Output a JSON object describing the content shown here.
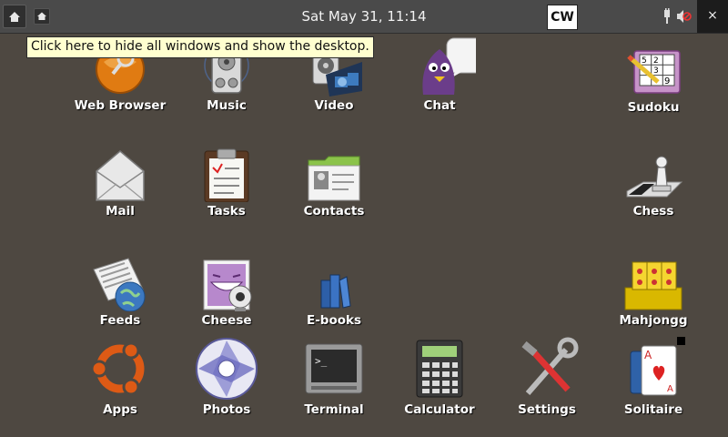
{
  "topbar": {
    "clock": "Sat May 31, 11:14",
    "cw_label": "CW",
    "close_label": "×"
  },
  "tooltip": "Click here to hide all windows and show the desktop.",
  "apps": {
    "web_browser": "Web Browser",
    "music": "Music",
    "video": "Video",
    "chat": "Chat",
    "sudoku": "Sudoku",
    "mail": "Mail",
    "tasks": "Tasks",
    "contacts": "Contacts",
    "chess": "Chess",
    "feeds": "Feeds",
    "cheese": "Cheese",
    "ebooks": "E-books",
    "mahjongg": "Mahjongg",
    "apps": "Apps",
    "photos": "Photos",
    "terminal": "Terminal",
    "calculator": "Calculator",
    "settings": "Settings",
    "solitaire": "Solitaire"
  },
  "icons": {
    "show_desktop": "home-icon",
    "second_desktop": "home-small-icon",
    "tray_power": "power-plug-icon",
    "tray_volume": "volume-muted-icon"
  }
}
